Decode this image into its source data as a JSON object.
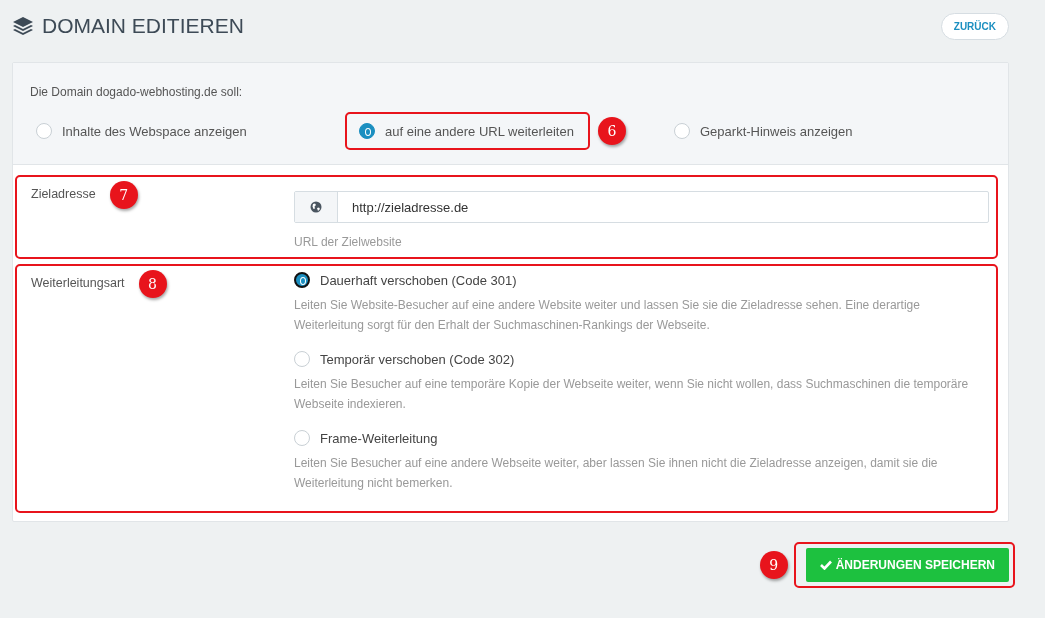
{
  "header": {
    "title": "DOMAIN EDITIEREN",
    "back_button": "ZURÜCK"
  },
  "domain_mode": {
    "prompt": "Die Domain dogado-webhosting.de soll:",
    "options": [
      {
        "label": "Inhalte des Webspace anzeigen",
        "selected": false
      },
      {
        "label": "auf eine andere URL weiterleiten",
        "selected": true,
        "marker": "6"
      },
      {
        "label": "Geparkt-Hinweis anzeigen",
        "selected": false
      }
    ]
  },
  "target": {
    "label": "Zieladresse",
    "marker": "7",
    "value": "http://zieladresse.de",
    "hint": "URL der Zielwebsite"
  },
  "redirect_type": {
    "label": "Weiterleitungsart",
    "marker": "8",
    "options": [
      {
        "label": "Dauerhaft verschoben (Code 301)",
        "selected": true,
        "description": "Leiten Sie Website-Besucher auf eine andere Website weiter und lassen Sie sie die Zieladresse sehen. Eine derartige Weiterleitung sorgt für den Erhalt der Suchmaschinen-Rankings der Webseite."
      },
      {
        "label": "Temporär verschoben (Code 302)",
        "selected": false,
        "description": "Leiten Sie Besucher auf eine temporäre Kopie der Webseite weiter, wenn Sie nicht wollen, dass Suchmaschinen die temporäre Webseite indexieren."
      },
      {
        "label": "Frame-Weiterleitung",
        "selected": false,
        "description": "Leiten Sie Besucher auf eine andere Webseite weiter, aber lassen Sie ihnen nicht die Zieladresse anzeigen, damit sie die Weiterleitung nicht bemerken."
      }
    ]
  },
  "save": {
    "label": "ÄNDERUNGEN SPEICHERN",
    "marker": "9"
  }
}
